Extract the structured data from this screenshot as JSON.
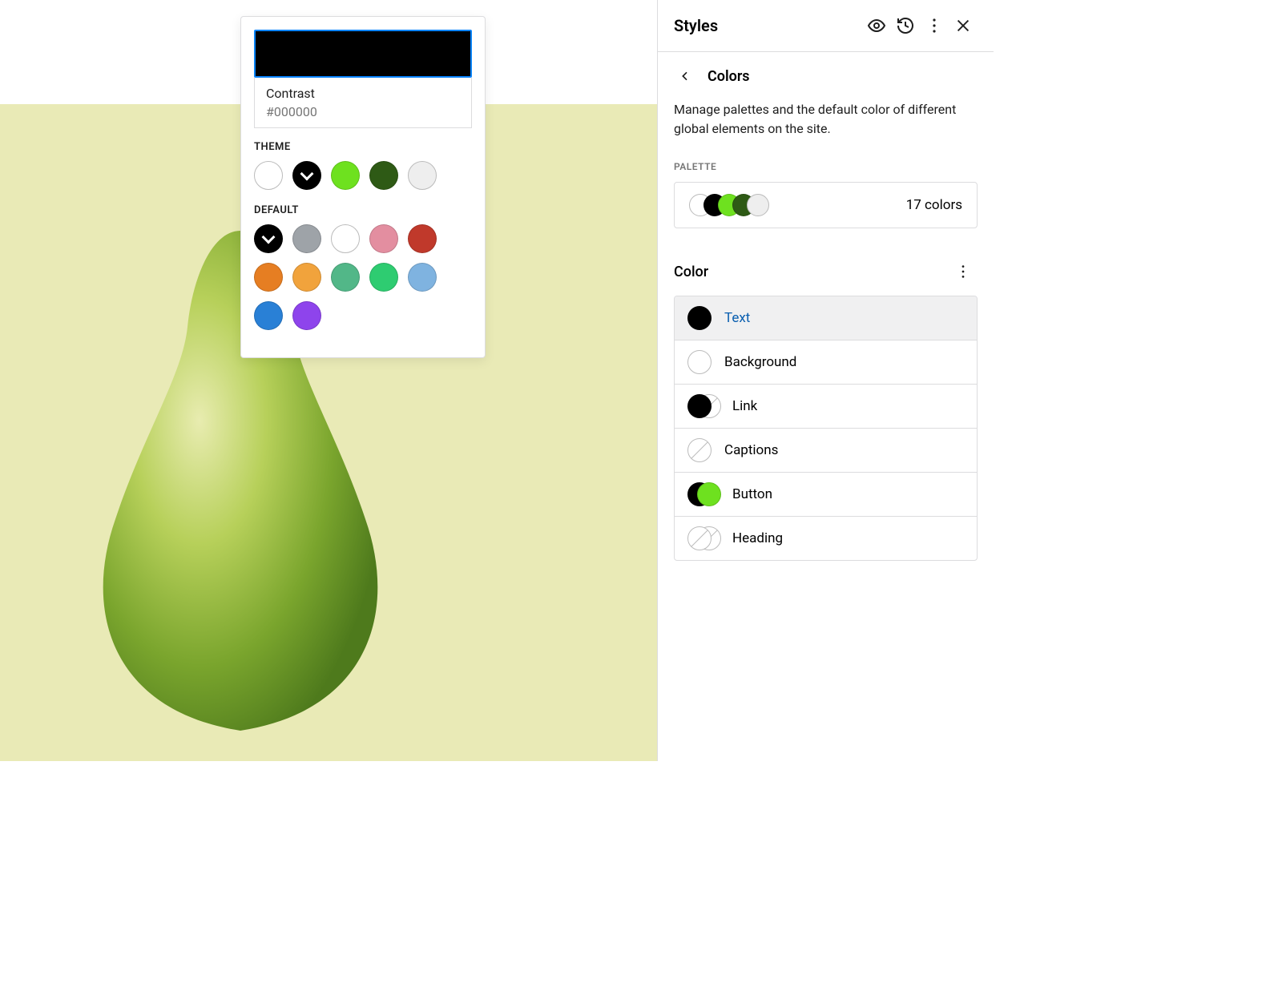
{
  "panel": {
    "title": "Styles",
    "section": "Colors",
    "description": "Manage palettes and the default color of different global elements on the site.",
    "palette_label": "PALETTE",
    "palette_count": "17 colors",
    "palette_preview": [
      "#ffffff",
      "#000000",
      "#6ee11f",
      "#2e5a15",
      "#eeeeee"
    ],
    "color_heading": "Color",
    "color_items": [
      {
        "label": "Text",
        "swatch_type": "solid",
        "color": "#000000",
        "active": true
      },
      {
        "label": "Background",
        "swatch_type": "solid",
        "color": "#ffffff"
      },
      {
        "label": "Link",
        "swatch_type": "duo",
        "c1": "#000000",
        "c2": "none"
      },
      {
        "label": "Captions",
        "swatch_type": "none"
      },
      {
        "label": "Button",
        "swatch_type": "duo",
        "c1": "#000000",
        "c2": "#6ee11f",
        "overlap": true
      },
      {
        "label": "Heading",
        "swatch_type": "duo",
        "c1": "none",
        "c2": "none"
      }
    ]
  },
  "popover": {
    "current_name": "Contrast",
    "current_hex": "#000000",
    "current_color": "#000000",
    "theme_label": "THEME",
    "theme": [
      {
        "color": "#ffffff"
      },
      {
        "color": "#000000",
        "selected": true
      },
      {
        "color": "#6ee11f"
      },
      {
        "color": "#2e5a15"
      },
      {
        "color": "#eeeeee"
      }
    ],
    "default_label": "DEFAULT",
    "default": [
      {
        "color": "#000000",
        "selected": true
      },
      {
        "color": "#9ea3a8"
      },
      {
        "color": "#ffffff"
      },
      {
        "color": "#e38ea0"
      },
      {
        "color": "#c0392b"
      },
      {
        "color": "#e67e22"
      },
      {
        "color": "#f1a33c"
      },
      {
        "color": "#52b788"
      },
      {
        "color": "#2ecc71"
      },
      {
        "color": "#7fb3e0"
      },
      {
        "color": "#2980d6"
      },
      {
        "color": "#8e44ec"
      }
    ]
  }
}
